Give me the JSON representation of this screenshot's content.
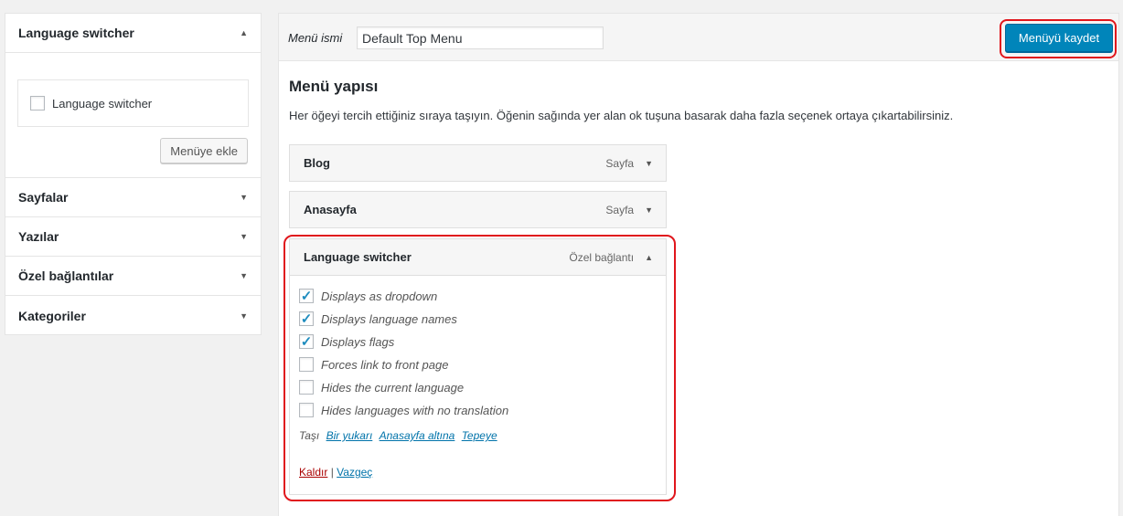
{
  "left": {
    "language_switcher": {
      "title": "Language switcher",
      "checkbox_label": "Language switcher",
      "add_button": "Menüye ekle"
    },
    "sections": [
      "Sayfalar",
      "Yazılar",
      "Özel bağlantılar",
      "Kategoriler"
    ]
  },
  "header": {
    "menu_name_label": "Menü ismi",
    "menu_name_value": "Default Top Menu",
    "save_button": "Menüyü kaydet"
  },
  "structure": {
    "title": "Menü yapısı",
    "description": "Her öğeyi tercih ettiğiniz sıraya taşıyın. Öğenin sağında yer alan ok tuşuna basarak daha fazla seçenek ortaya çıkartabilirsiniz.",
    "items": [
      {
        "name": "Blog",
        "type": "Sayfa"
      },
      {
        "name": "Anasayfa",
        "type": "Sayfa"
      }
    ],
    "expanded": {
      "name": "Language switcher",
      "type": "Özel bağlantı",
      "options": [
        {
          "label": "Displays as dropdown",
          "checked": true
        },
        {
          "label": "Displays language names",
          "checked": true
        },
        {
          "label": "Displays flags",
          "checked": true
        },
        {
          "label": "Forces link to front page",
          "checked": false
        },
        {
          "label": "Hides the current language",
          "checked": false
        },
        {
          "label": "Hides languages with no translation",
          "checked": false
        }
      ],
      "move_label": "Taşı",
      "move_links": [
        "Bir yukarı",
        "Anasayfa altına",
        "Tepeye"
      ],
      "remove": "Kaldır",
      "separator": "|",
      "cancel": "Vazgeç"
    }
  },
  "colors": {
    "primary": "#0085ba",
    "highlight": "#e0161c",
    "link": "#0073aa",
    "remove": "#aa0000"
  }
}
